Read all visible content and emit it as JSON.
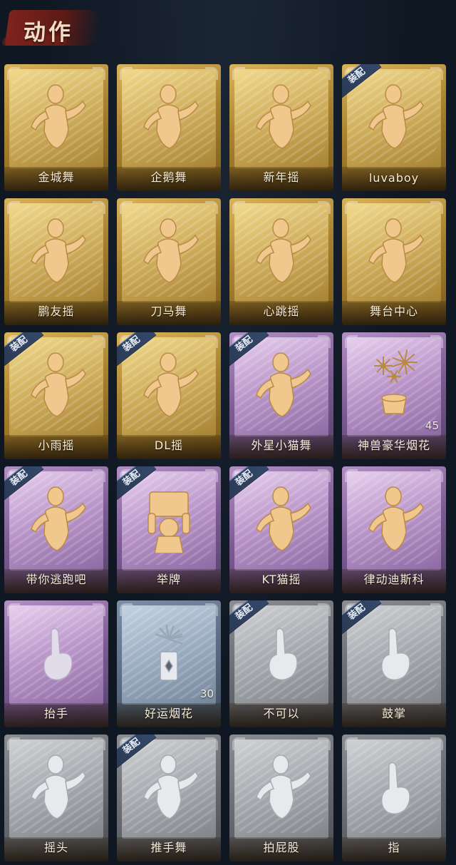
{
  "header": {
    "title": "动作"
  },
  "equip_label": "装配",
  "colors": {
    "gold": "#c9a24a",
    "purple": "#9b77b0",
    "blue": "#8d9db1",
    "grey": "#9a9da2",
    "background": "#0f1722",
    "equip_badge": "#34486a"
  },
  "items": [
    {
      "label": "金城舞",
      "rarity": "gold",
      "equipped": false,
      "icon": "dancer-icon"
    },
    {
      "label": "企鹅舞",
      "rarity": "gold",
      "equipped": false,
      "icon": "dancer-icon"
    },
    {
      "label": "新年摇",
      "rarity": "gold",
      "equipped": false,
      "icon": "dancer-icon"
    },
    {
      "label": "luvaboy",
      "rarity": "gold",
      "equipped": true,
      "icon": "dancer-icon"
    },
    {
      "label": "鹏友摇",
      "rarity": "gold",
      "equipped": false,
      "icon": "dancer-icon"
    },
    {
      "label": "刀马舞",
      "rarity": "gold",
      "equipped": false,
      "icon": "dancer-icon"
    },
    {
      "label": "心跳摇",
      "rarity": "gold",
      "equipped": false,
      "icon": "dancer-icon"
    },
    {
      "label": "舞台中心",
      "rarity": "gold",
      "equipped": false,
      "icon": "dancer-icon"
    },
    {
      "label": "小雨摇",
      "rarity": "gold",
      "equipped": true,
      "icon": "dancer-icon"
    },
    {
      "label": "DL摇",
      "rarity": "gold",
      "equipped": true,
      "icon": "dancer-icon"
    },
    {
      "label": "外星小猫舞",
      "rarity": "purple",
      "equipped": true,
      "icon": "dancer-icon"
    },
    {
      "label": "神兽豪华烟花",
      "rarity": "purple",
      "equipped": false,
      "icon": "fireworks-icon",
      "count": "45"
    },
    {
      "label": "带你逃跑吧",
      "rarity": "purple",
      "equipped": true,
      "icon": "dancer-icon"
    },
    {
      "label": "举牌",
      "rarity": "purple",
      "equipped": true,
      "icon": "sign-icon"
    },
    {
      "label": "KT猫摇",
      "rarity": "purple",
      "equipped": true,
      "icon": "dancer-icon"
    },
    {
      "label": "律动迪斯科",
      "rarity": "purple",
      "equipped": false,
      "icon": "dancer-icon"
    },
    {
      "label": "抬手",
      "rarity": "purple-faded",
      "equipped": false,
      "icon": "raise-hand-icon"
    },
    {
      "label": "好运烟花",
      "rarity": "blue",
      "equipped": false,
      "icon": "firework-can-icon",
      "count": "30"
    },
    {
      "label": "不可以",
      "rarity": "grey",
      "equipped": true,
      "icon": "finger-icon"
    },
    {
      "label": "鼓掌",
      "rarity": "grey",
      "equipped": true,
      "icon": "clap-icon"
    },
    {
      "label": "摇头",
      "rarity": "grey",
      "equipped": false,
      "icon": "dancer-icon"
    },
    {
      "label": "推手舞",
      "rarity": "grey",
      "equipped": true,
      "icon": "dancer-icon"
    },
    {
      "label": "拍屁股",
      "rarity": "grey",
      "equipped": false,
      "icon": "dancer-icon"
    },
    {
      "label": "指",
      "rarity": "grey",
      "equipped": false,
      "icon": "point-hand-icon"
    }
  ]
}
